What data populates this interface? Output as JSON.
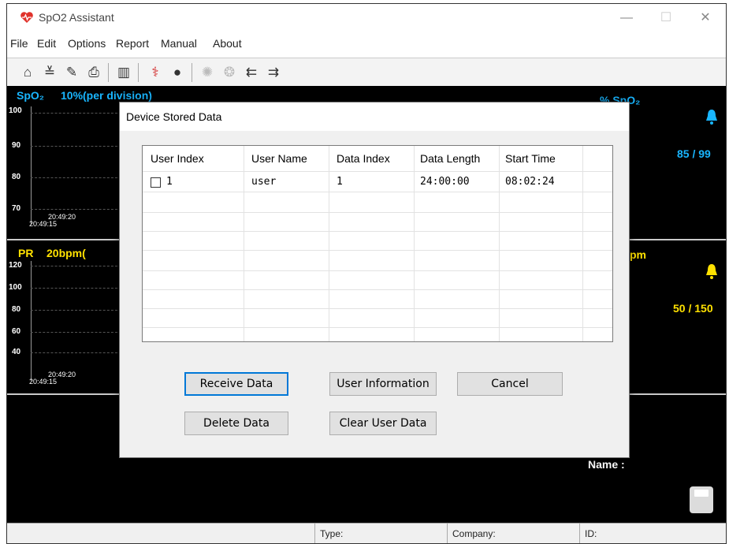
{
  "window": {
    "title": "SpO2 Assistant",
    "minimize": "—",
    "maximize": "☐",
    "close": "✕"
  },
  "menu": [
    "File",
    "Edit",
    "Options",
    "Report",
    "Manual",
    "About"
  ],
  "spo2_panel": {
    "label": "SpO₂",
    "scale": "10%(per division)",
    "ticks": [
      "100",
      "90",
      "80",
      "70"
    ],
    "time_start": "20:49:15",
    "time_mid": "20:49:20",
    "right_label": "% SpO₂",
    "range": "85 / 99"
  },
  "pr_panel": {
    "label": "PR",
    "scale": "20bpm(",
    "ticks": [
      "120",
      "100",
      "80",
      "60",
      "40"
    ],
    "time_start": "20:49:15",
    "time_mid": "20:49:20",
    "right_label": "pm",
    "range": "50 / 150"
  },
  "name_label": "Name :",
  "status_bar": {
    "type": "Type:",
    "company": "Company:",
    "id": "ID:"
  },
  "dialog": {
    "title": "Device Stored Data",
    "columns": [
      "User Index",
      "User Name",
      "Data Index",
      "Data Length",
      "Start Time"
    ],
    "rows": [
      {
        "user_index": "1",
        "user_name": "user",
        "data_index": "1",
        "data_length": "24:00:00",
        "start_time": "08:02:24",
        "checked": false
      }
    ],
    "buttons": {
      "receive": "Receive Data",
      "user_info": "User Information",
      "cancel": "Cancel",
      "delete": "Delete Data",
      "clear": "Clear User Data"
    }
  },
  "colors": {
    "cyan": "#19b6ff",
    "yellow": "#ffe100",
    "brand_red": "#e0322b"
  }
}
